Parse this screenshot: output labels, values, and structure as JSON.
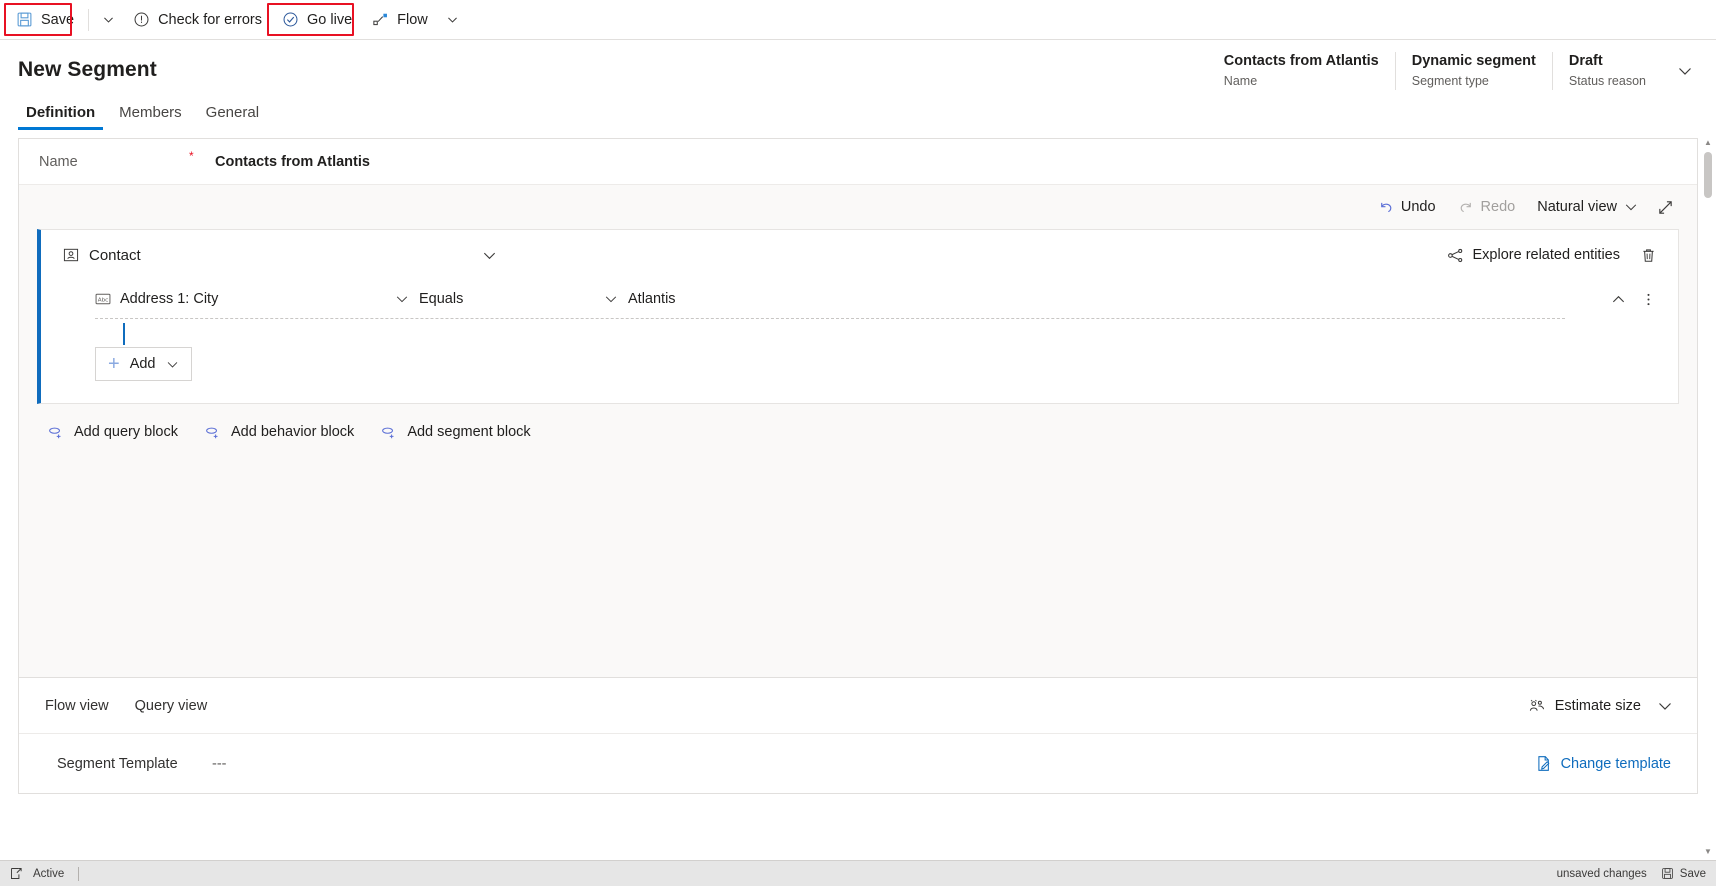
{
  "command_bar": {
    "save_label": "Save",
    "save_caret": "chevron-down",
    "check_errors_label": "Check for errors",
    "go_live_label": "Go live",
    "flow_label": "Flow",
    "flow_caret": "chevron-down",
    "highlight_color": "#e81123"
  },
  "header": {
    "title": "New Segment",
    "meta": [
      {
        "value": "Contacts from Atlantis",
        "label": "Name"
      },
      {
        "value": "Dynamic segment",
        "label": "Segment type"
      },
      {
        "value": "Draft",
        "label": "Status reason"
      }
    ]
  },
  "tabs": [
    {
      "label": "Definition",
      "active": true
    },
    {
      "label": "Members",
      "active": false
    },
    {
      "label": "General",
      "active": false
    }
  ],
  "form": {
    "name_label": "Name",
    "required_marker": "*",
    "name_value": "Contacts from Atlantis"
  },
  "designer_toolbar": {
    "undo_label": "Undo",
    "redo_label": "Redo",
    "view_label": "Natural view",
    "expand_icon": "expand-diagonal-icon"
  },
  "query_block": {
    "entity_label": "Contact",
    "explore_label": "Explore related entities",
    "delete_icon": "trash-icon",
    "condition": {
      "field": "Address 1: City",
      "operator": "Equals",
      "value": "Atlantis"
    },
    "add_label": "Add"
  },
  "block_adders": [
    {
      "label": "Add query block"
    },
    {
      "label": "Add behavior block"
    },
    {
      "label": "Add segment block"
    }
  ],
  "footer_panel": {
    "views": [
      {
        "label": "Flow view"
      },
      {
        "label": "Query view"
      }
    ],
    "estimate_label": "Estimate size",
    "template_label": "Segment Template",
    "template_value": "---",
    "change_template_label": "Change template"
  },
  "status_bar": {
    "active_label": "Active",
    "unsaved_label": "unsaved changes",
    "save_label": "Save"
  },
  "colors": {
    "accent": "#0f6cbd",
    "tab_underline": "#0078d4",
    "required": "#e81123",
    "canvas_bg": "#faf9f8"
  }
}
